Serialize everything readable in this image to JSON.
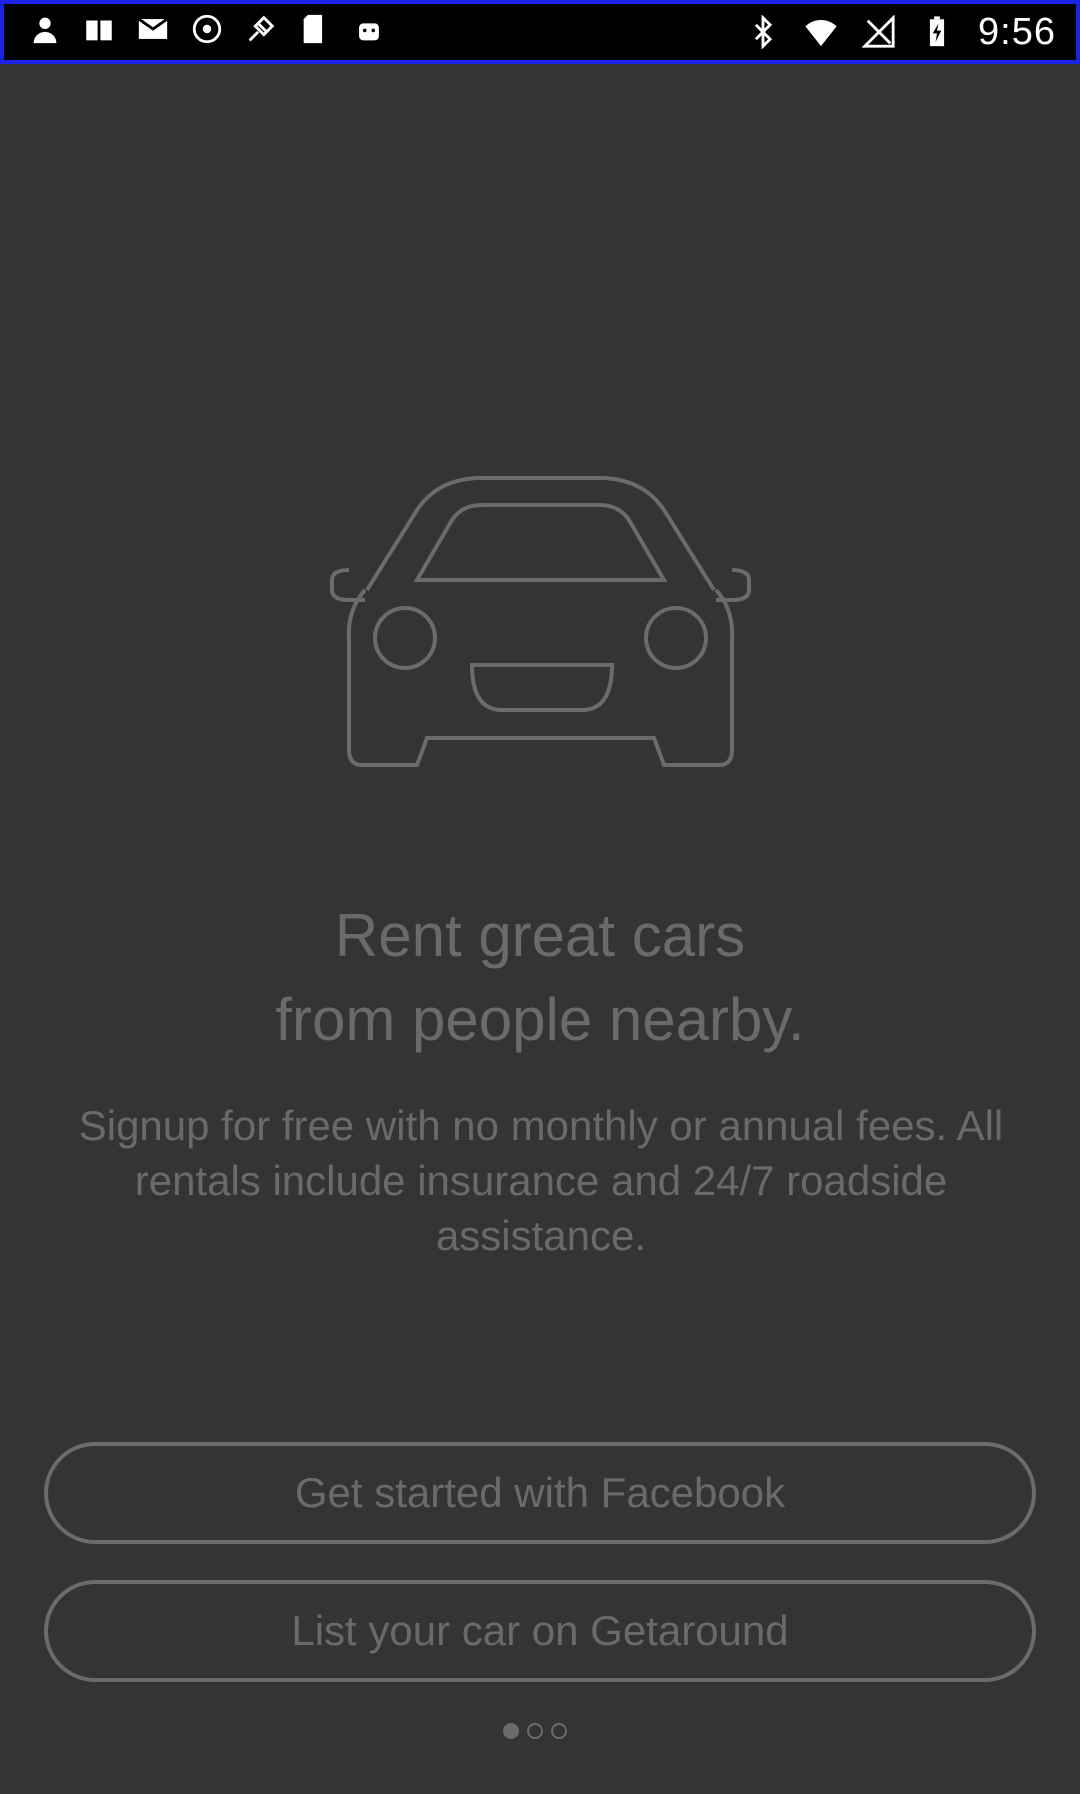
{
  "status_bar": {
    "time": "9:56",
    "left_icons": [
      "notification-person-icon",
      "notification-app-icon",
      "mail-icon",
      "record-icon",
      "satellite-icon",
      "sd-card-icon",
      "android-icon"
    ],
    "right_icons": [
      "bluetooth-icon",
      "wifi-icon",
      "no-signal-icon",
      "battery-charging-icon"
    ]
  },
  "hero": {
    "image": "car-icon",
    "headline_line1": "Rent great cars",
    "headline_line2": "from people nearby.",
    "body": "Signup for free with no monthly or annual fees. All rentals include insurance and 24/7 roadside assistance."
  },
  "actions": {
    "facebook_label": "Get started with Facebook",
    "list_car_label": "List your car on Getaround"
  },
  "page_indicator": {
    "pages": 3,
    "active_index": 0
  },
  "colors": {
    "background": "#343434",
    "text_muted": "#6a6a6a",
    "outline": "#6b6b6b",
    "status_bar": "#000000"
  }
}
